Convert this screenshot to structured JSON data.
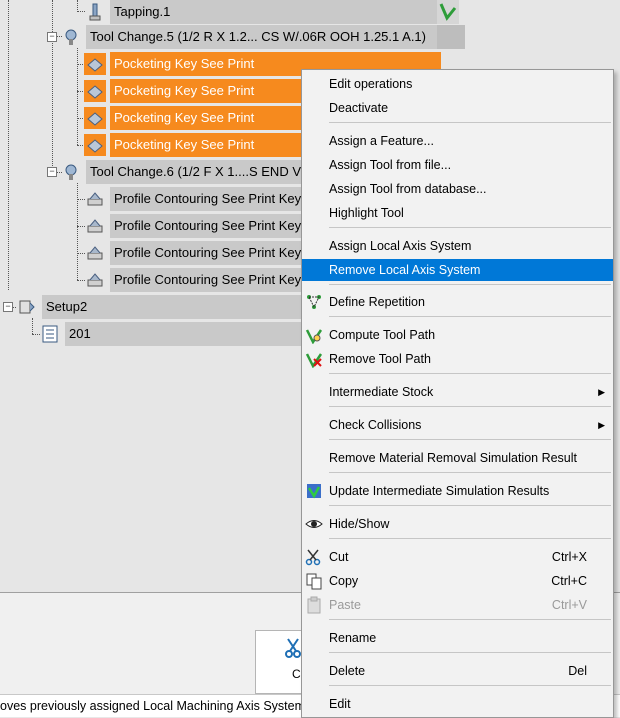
{
  "tree": {
    "tapping": "Tapping.1",
    "tool_change_5": "Tool Change.5 (1/2 R X 1.2... CS W/.06R OOH 1.25.1 A.1)",
    "pocketing": [
      "Pocketing Key See Print",
      "Pocketing Key See Print",
      "Pocketing Key See Print",
      "Pocketing Key See Print"
    ],
    "tool_change_6": "Tool Change.6 (1/2 F X 1....S END V",
    "profile": [
      "Profile Contouring See Print Key",
      "Profile Contouring See Print Key",
      "Profile Contouring See Print Key",
      "Profile Contouring See Print Key"
    ],
    "setup2": "Setup2",
    "part": "201"
  },
  "menu": {
    "items": [
      {
        "label": "Edit operations",
        "key": "E"
      },
      {
        "label": "Deactivate",
        "key": "D"
      },
      {
        "label": "Assign a Feature...",
        "key": "A"
      },
      {
        "label": "Assign Tool from file...",
        "key": "s"
      },
      {
        "label": "Assign Tool from database...",
        "key": "g"
      },
      {
        "label": "Highlight Tool",
        "key": "H"
      },
      {
        "label": "Assign Local Axis System",
        "key": "i"
      },
      {
        "label": "Remove Local Axis System",
        "key": "R"
      },
      {
        "label": "Define Repetition",
        "key": "e"
      },
      {
        "label": "Compute Tool Path",
        "key": "C"
      },
      {
        "label": "Remove Tool Path",
        "key": "R"
      },
      {
        "label": "Intermediate Stock",
        "key": "I"
      },
      {
        "label": "Check Collisions",
        "key": "k"
      },
      {
        "label": "Remove Material Removal Simulation Result",
        "key": "v"
      },
      {
        "label": "Update Intermediate Simulation Results",
        "key": "U"
      },
      {
        "label": "Hide/Show",
        "key": "S"
      },
      {
        "label": "Cut",
        "shortcut": "Ctrl+X"
      },
      {
        "label": "Copy",
        "shortcut": "Ctrl+C"
      },
      {
        "label": "Paste",
        "shortcut": "Ctrl+V"
      },
      {
        "label": "Rename"
      },
      {
        "label": "Delete",
        "shortcut": "Del"
      },
      {
        "label": "Edit"
      }
    ]
  },
  "status": {
    "text": "oves previously assigned Local Machining Axis System for"
  },
  "bottom_tab": {
    "label": "C"
  },
  "colors": {
    "selection_orange": "#f68a1e",
    "menu_highlight": "#0078d7"
  }
}
